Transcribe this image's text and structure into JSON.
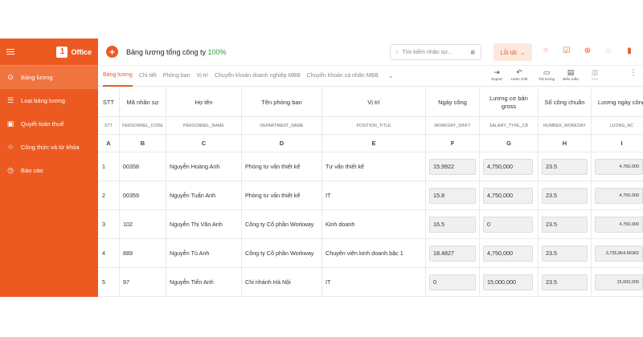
{
  "sidebar": {
    "logo_text": "Office",
    "items": [
      {
        "label": "Bảng lương",
        "icon": "dollar-circle-icon",
        "glyph": "⊙"
      },
      {
        "label": "Loại bảng lương",
        "icon": "list-icon",
        "glyph": "☰"
      },
      {
        "label": "Quyết toán thuế",
        "icon": "clipboard-icon",
        "glyph": "▣"
      },
      {
        "label": "Công thức và từ khóa",
        "icon": "star-icon",
        "glyph": "☆"
      },
      {
        "label": "Báo cáo",
        "icon": "clock-icon",
        "glyph": "◷"
      }
    ]
  },
  "header": {
    "title": "Bảng lương tổng công ty",
    "percent": "100%",
    "search_placeholder": "Tìm kiếm nhân sự...",
    "error_label": "Lỗi tất"
  },
  "tabs": [
    "Bảng lương",
    "Chi tiết",
    "Phòng ban",
    "Vị trí",
    "Chuyển khoản doanh nghiệp MBB",
    "Chuyển khoản cá nhân MBB"
  ],
  "actions": [
    {
      "label": "Export",
      "icon": "export-icon",
      "glyph": "⇥"
    },
    {
      "label": "Hoàn chốt",
      "icon": "undo-icon",
      "glyph": "↶"
    },
    {
      "label": "Trả lương",
      "icon": "pay-icon",
      "glyph": "▭"
    },
    {
      "label": "Biểu mẫu",
      "icon": "template-icon",
      "glyph": "▤"
    },
    {
      "label": "Xóa",
      "icon": "trash-icon",
      "glyph": "▥"
    }
  ],
  "table": {
    "headers": [
      "STT",
      "Mã nhân sự",
      "Họ tên",
      "Tên phòng ban",
      "Vị trí",
      "Ngày công",
      "Lương cơ bản gross",
      "Số công chuẩn",
      "Lương ngày công"
    ],
    "codes": [
      "STT",
      "PERSONNEL_CODE",
      "PERSONNEL_NAME",
      "DEPARTMENT_NAME",
      "POSITION_TITLE",
      "WORKDAY_SHIFT",
      "SALARY_TYPE_CB",
      "NUMBER_WORKDAY",
      "LUONG_NC"
    ],
    "letters": [
      "A",
      "B",
      "C",
      "D",
      "E",
      "F",
      "G",
      "H",
      "I"
    ],
    "rows": [
      {
        "stt": "1",
        "code": "00358",
        "name": "Nguyễn Hoàng Anh",
        "dept": "Phòng tư vấn thiết kế",
        "position": "Tư vấn thiết kế",
        "workday": "15.9922",
        "salary": "4,750,000",
        "std": "23.5",
        "daily": "4,750,000"
      },
      {
        "stt": "2",
        "code": "00359",
        "name": "Nguyễn Tuấn Anh",
        "dept": "Phòng tư vấn thiết kế",
        "position": "IT",
        "workday": "15.8",
        "salary": "4,750,000",
        "std": "23.5",
        "daily": "4,750,000"
      },
      {
        "stt": "3",
        "code": "102",
        "name": "Nguyễn Thị Vân Anh",
        "dept": "Công ty Cổ phần Workway",
        "position": "Kinh doanh",
        "workday": "16.5",
        "salary": "0",
        "std": "23.5",
        "daily": "4,750,000"
      },
      {
        "stt": "4",
        "code": "889",
        "name": "Nguyễn Tú Anh",
        "dept": "Công ty Cổ phần Workway",
        "position": "Chuyên viên kinh doanh bậc 1",
        "workday": "18.4827",
        "salary": "4,750,000",
        "std": "23.5",
        "daily": "3,735,864.89362"
      },
      {
        "stt": "5",
        "code": "97",
        "name": "Nguyễn Tiến Anh",
        "dept": "Chi nhánh Hà Nội",
        "position": "IT",
        "workday": "0",
        "salary": "15,000,000",
        "std": "23.5",
        "daily": "15,000,000"
      }
    ]
  },
  "colors": {
    "accent": "#ec5a22",
    "percent": "#2a9d3a"
  }
}
